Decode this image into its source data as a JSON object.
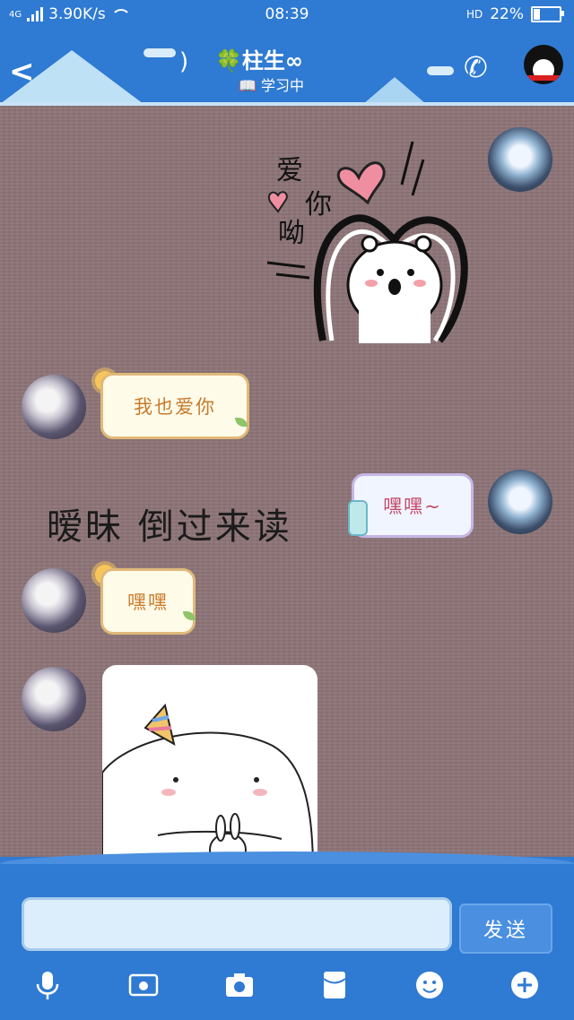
{
  "status_bar": {
    "network": "4G",
    "speed": "3.90K/s",
    "time": "08:39",
    "hd": "HD",
    "battery_percent": "22%",
    "battery_level": 0.22
  },
  "header": {
    "title": "🍀柱生∞",
    "subtitle": "📖 学习中"
  },
  "messages": [
    {
      "side": "me",
      "type": "sticker",
      "texts": [
        "爱",
        "你",
        "呦"
      ]
    },
    {
      "side": "other",
      "type": "text",
      "text": "我也爱你"
    },
    {
      "side": "background",
      "type": "overlay_text",
      "text": "暧昧  倒过来读"
    },
    {
      "side": "me",
      "type": "text",
      "text": "嘿嘿~"
    },
    {
      "side": "other",
      "type": "text",
      "text": "嘿嘿"
    },
    {
      "side": "other",
      "type": "sticker"
    }
  ],
  "composer": {
    "input_value": "",
    "send_label": "发送"
  },
  "toolbar": [
    "mic-icon",
    "image-icon",
    "camera-icon",
    "red-envelope-icon",
    "emoji-icon",
    "plus-icon"
  ]
}
